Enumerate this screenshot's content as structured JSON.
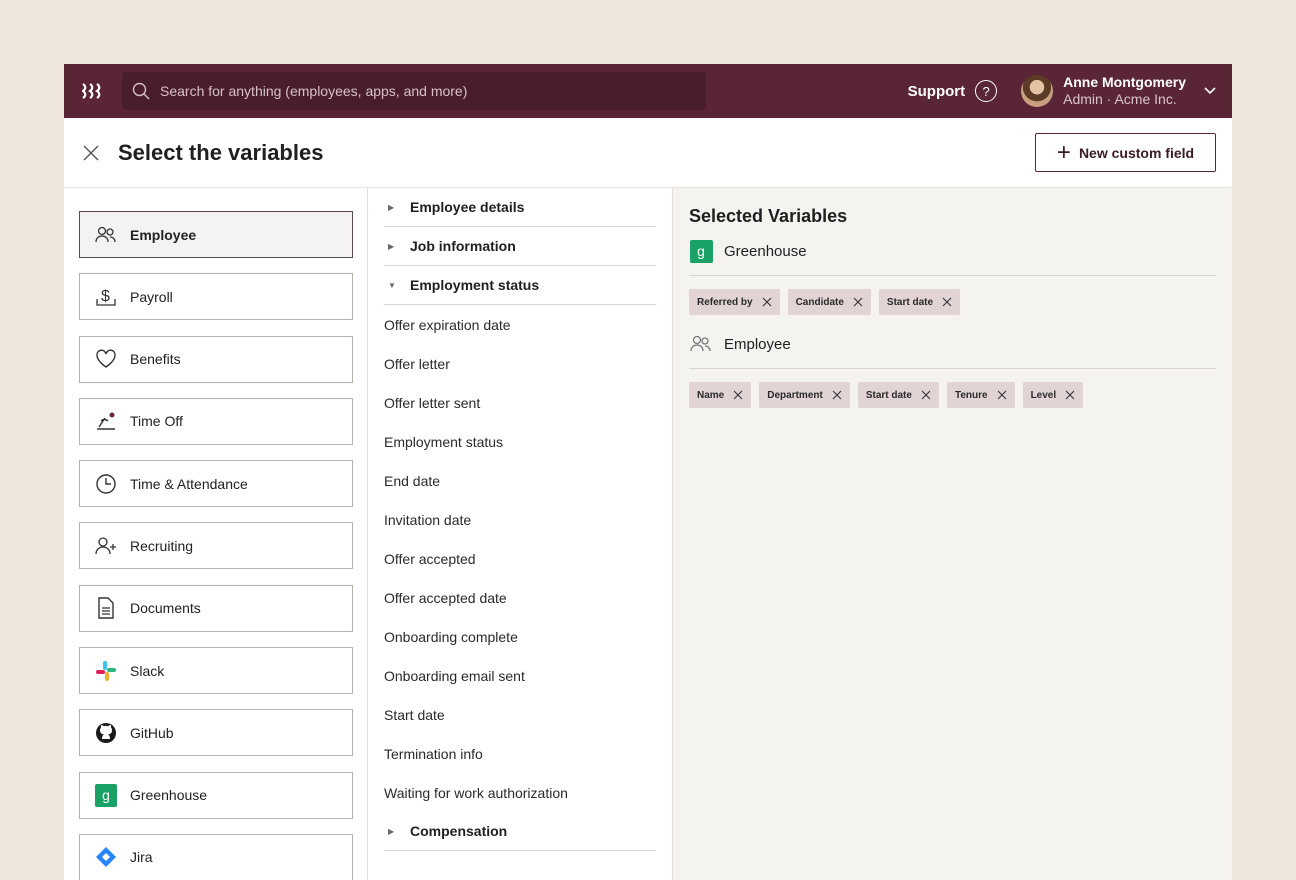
{
  "topbar": {
    "logo": "ꝛꝛꝛ",
    "search_placeholder": "Search for anything (employees, apps, and more)",
    "support_label": "Support",
    "user_name": "Anne Montgomery",
    "user_role": "Admin · Acme Inc."
  },
  "header": {
    "title": "Select the variables",
    "new_field_label": "New custom field"
  },
  "categories": [
    {
      "label": "Employee",
      "icon": "people-icon",
      "active": true
    },
    {
      "label": "Payroll",
      "icon": "dollar-icon"
    },
    {
      "label": "Benefits",
      "icon": "heart-icon"
    },
    {
      "label": "Time Off",
      "icon": "beach-icon"
    },
    {
      "label": "Time & Attendance",
      "icon": "clock-icon"
    },
    {
      "label": "Recruiting",
      "icon": "person-add-icon"
    },
    {
      "label": "Documents",
      "icon": "document-icon"
    },
    {
      "label": "Slack",
      "icon": "slack-icon"
    },
    {
      "label": "GitHub",
      "icon": "github-icon"
    },
    {
      "label": "Greenhouse",
      "icon": "greenhouse-icon"
    },
    {
      "label": "Jira",
      "icon": "jira-icon"
    }
  ],
  "middle": {
    "sections": {
      "employee_details": "Employee details",
      "job_information": "Job information",
      "employment_status": "Employment status",
      "compensation": "Compensation"
    },
    "fields": [
      "Offer expiration date",
      "Offer letter",
      "Offer letter sent",
      "Employment status",
      "End date",
      "Invitation date",
      "Offer accepted",
      "Offer accepted date",
      "Onboarding complete",
      "Onboarding email sent",
      "Start date",
      "Termination info",
      "Waiting for work authorization"
    ]
  },
  "selected": {
    "title": "Selected Variables",
    "groups": [
      {
        "source": "Greenhouse",
        "icon": "greenhouse-icon",
        "chips": [
          "Referred by",
          "Candidate",
          "Start date"
        ]
      },
      {
        "source": "Employee",
        "icon": "people-icon",
        "chips": [
          "Name",
          "Department",
          "Start date",
          "Tenure",
          "Level"
        ]
      }
    ]
  },
  "colors": {
    "brand": "#5a2636",
    "chip_bg": "#e2d4d5",
    "greenhouse": "#19a166",
    "page_bg": "#efe6dd"
  }
}
